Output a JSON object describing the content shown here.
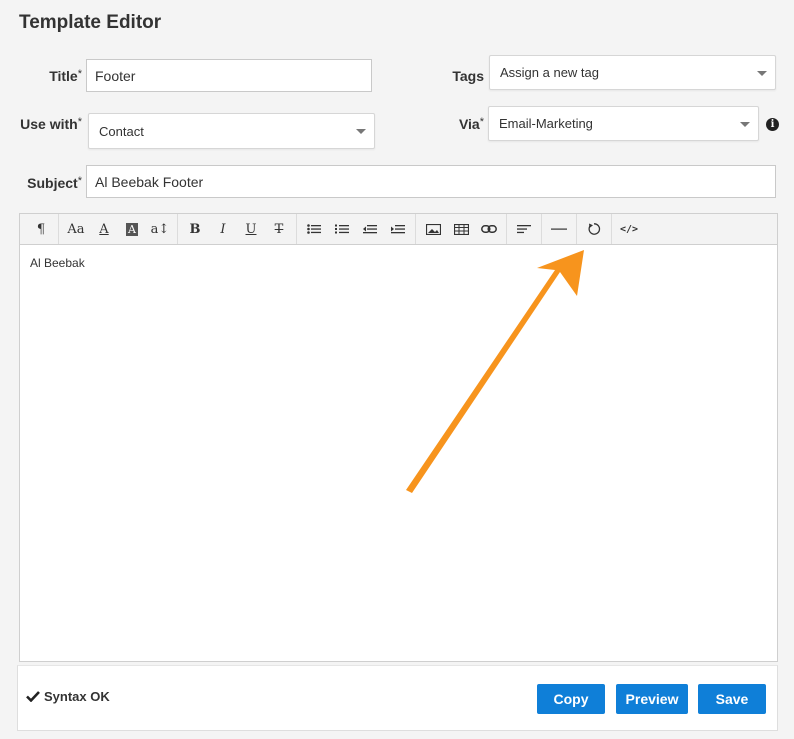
{
  "page": {
    "title": "Template Editor"
  },
  "form": {
    "title_label": "Title",
    "title_value": "Footer",
    "tags_label": "Tags",
    "tags_value": "Assign a new tag",
    "usewith_label": "Use with",
    "usewith_value": "Contact",
    "via_label": "Via",
    "via_value": "Email-Marketing",
    "subject_label": "Subject",
    "subject_value": "Al Beebak Footer",
    "required_mark": "*"
  },
  "toolbar": {
    "paragraph": "¶",
    "font_family": "Aa",
    "font_color": "A",
    "bg_color": "A",
    "font_size": "a↕",
    "bold": "B",
    "italic": "I",
    "underline": "U",
    "strike": "T",
    "code_view": "</>"
  },
  "editor": {
    "content": "Al Beebak"
  },
  "footer": {
    "syntax_status": "Syntax OK",
    "copy_label": "Copy",
    "preview_label": "Preview",
    "save_label": "Save"
  },
  "colors": {
    "accent": "#0f7fd8",
    "arrow": "#f7941d"
  }
}
